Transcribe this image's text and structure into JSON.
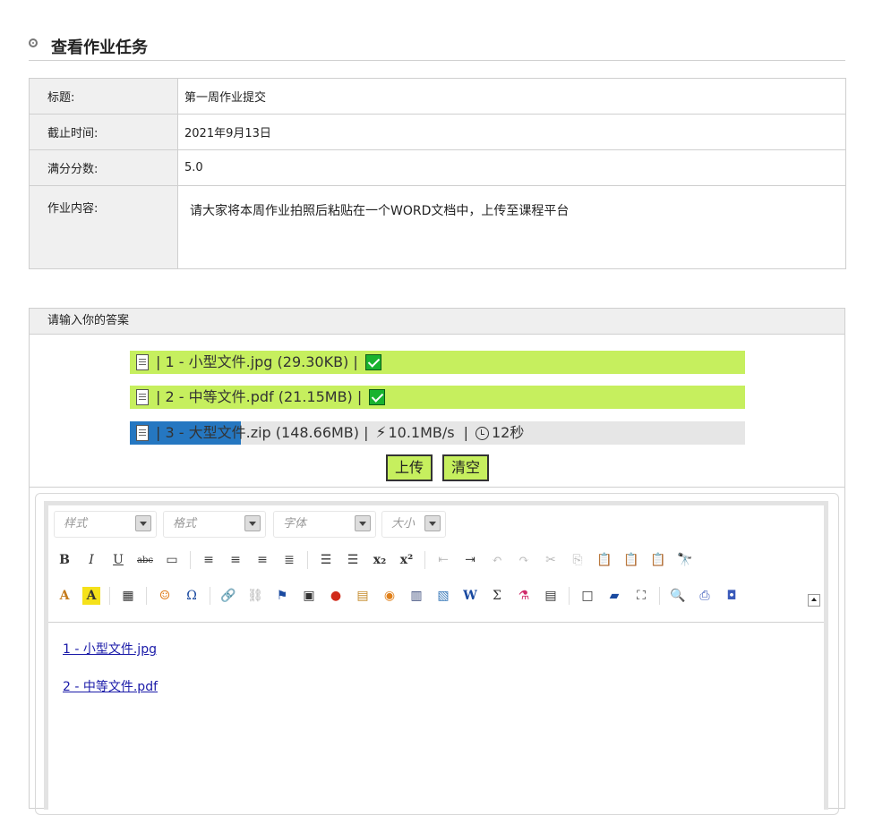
{
  "page": {
    "title": "查看作业任务"
  },
  "assignment": {
    "rows": [
      {
        "label": "标题:",
        "value": "第一周作业提交"
      },
      {
        "label": "截止时间:",
        "value": "2021年9月13日"
      },
      {
        "label": "满分分数:",
        "value": "5.0"
      },
      {
        "label": "作业内容:",
        "value": "请大家将本周作业拍照后粘贴在一个WORD文档中，上传至课程平台"
      }
    ]
  },
  "answer": {
    "header": "请输入你的答案",
    "files": [
      {
        "text": "| 1 - 小型文件.jpg (29.30KB) |",
        "status": "done"
      },
      {
        "text": "| 2 - 中等文件.pdf (21.15MB) |",
        "status": "done"
      },
      {
        "text": "| 3 - 大型文件.zip (148.66MB) |",
        "speed": "10.1MB/s",
        "sep": "|",
        "eta": "12秒",
        "status": "uploading",
        "progress": 0.18
      }
    ],
    "upload_label": "上传",
    "clear_label": "清空"
  },
  "editor": {
    "combos": {
      "style": "样式",
      "format": "格式",
      "font": "字体",
      "size": "大小"
    },
    "links": [
      "1 - 小型文件.jpg",
      "2 - 中等文件.pdf"
    ],
    "toolbar_row1": [
      "bold-icon",
      "italic-icon",
      "underline-icon",
      "strikethrough-icon",
      "horizontal-rule-icon",
      "align-left-icon",
      "align-center-icon",
      "align-right-icon",
      "justify-icon",
      "numbered-list-icon",
      "bulleted-list-icon",
      "subscript-icon",
      "superscript-icon",
      "outdent-icon",
      "indent-icon",
      "undo-icon",
      "redo-icon",
      "cut-icon",
      "copy-icon",
      "paste-icon",
      "paste-text-icon",
      "paste-word-icon",
      "find-icon"
    ],
    "toolbar_row2": [
      "text-color-icon",
      "background-color-icon",
      "table-icon",
      "emoticon-icon",
      "special-char-icon",
      "link-icon",
      "unlink-icon",
      "anchor-icon",
      "image-icon",
      "flash-icon",
      "media-icon",
      "video-icon",
      "file-icon",
      "attachment-icon",
      "word-icon",
      "formula-icon",
      "chemistry-icon",
      "template-icon",
      "new-page-icon",
      "eraser-icon",
      "fullscreen-icon",
      "preview-icon",
      "print-icon",
      "source-icon"
    ]
  }
}
